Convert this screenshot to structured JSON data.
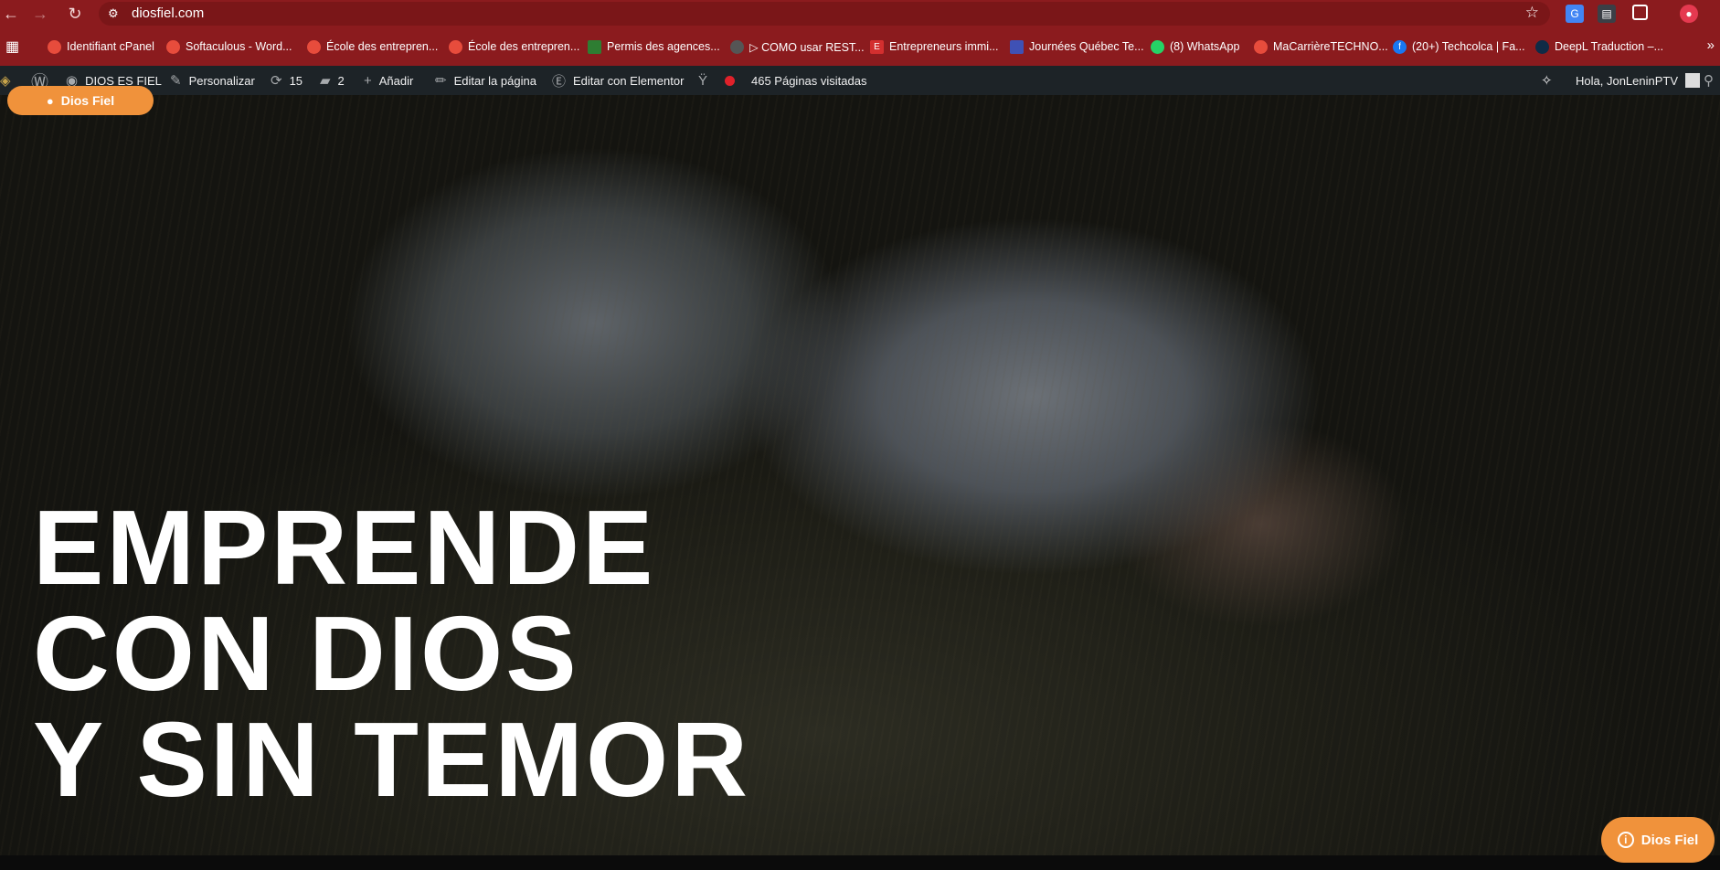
{
  "browser": {
    "url": "diosfiel.com",
    "back": "←",
    "forward": "→",
    "reload": "↻",
    "site_info_icon": "tune-icon",
    "star": "☆"
  },
  "bookmarks": [
    {
      "label": "Identifiant cPanel",
      "icon": "globe-icon",
      "color": "#e74c3c"
    },
    {
      "label": "Softaculous - Word...",
      "icon": "globe-icon",
      "color": "#e74c3c"
    },
    {
      "label": "École des entrepren...",
      "icon": "globe-icon",
      "color": "#e74c3c"
    },
    {
      "label": "École des entrepren...",
      "icon": "globe-icon",
      "color": "#e74c3c"
    },
    {
      "label": "Permis des agences...",
      "icon": "bird-icon",
      "color": "#2e7d32"
    },
    {
      "label": "▷ COMO usar REST...",
      "icon": "spinner-icon",
      "color": "#555"
    },
    {
      "label": "Entrepreneurs immi...",
      "icon": "e-icon",
      "color": "#d32f2f"
    },
    {
      "label": "Journées Québec Te...",
      "icon": "arrow-icon",
      "color": "#3f51b5"
    },
    {
      "label": "(8) WhatsApp",
      "icon": "whatsapp-icon",
      "color": "#25d366"
    },
    {
      "label": "MaCarrièreTECHNO...",
      "icon": "globe-icon",
      "color": "#e74c3c"
    },
    {
      "label": "(20+) Techcolca | Fa...",
      "icon": "facebook-icon",
      "color": "#1877f2"
    },
    {
      "label": "DeepL Traduction –...",
      "icon": "deepl-icon",
      "color": "#0f2b46"
    }
  ],
  "wpbar": {
    "site_name": "DIOS ES FIEL",
    "customize": "Personalizar",
    "updates": "15",
    "comments": "2",
    "add_new": "Añadir",
    "edit_page": "Editar la página",
    "edit_elementor": "Editar con Elementor",
    "pages_visited": "465 Páginas visitadas",
    "greeting": "Hola, JonLeninPTV"
  },
  "hero": {
    "line1": "EMPRENDE",
    "line2": "CON DIOS",
    "line3": "Y SIN TEMOR"
  },
  "badge_top": "Dios Fiel",
  "badge_bottom": "Dios Fiel",
  "colors": {
    "chrome": "#8b1b1e",
    "wpbar": "#1d2327",
    "accent": "#f0923b"
  }
}
